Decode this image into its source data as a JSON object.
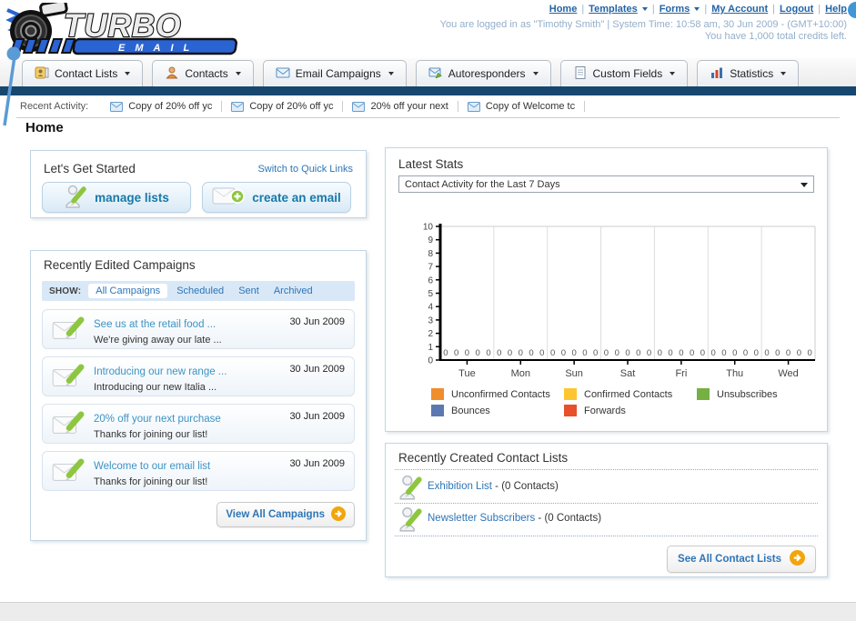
{
  "colors": {
    "navy_bar": "#17476e",
    "link_blue": "#2e75b6",
    "campaign_link": "#3d93c4",
    "accent_orange": "#f2a50c",
    "pencil_green": "#8dc63f",
    "muted_header_text": "#93aecb"
  },
  "header": {
    "logo": {
      "title": "TURBO",
      "subtitle": "EMAIL"
    },
    "separator": "|",
    "nav_links": [
      {
        "label": "Home"
      },
      {
        "label": "Templates"
      },
      {
        "label": "Forms"
      },
      {
        "label": "My Account"
      },
      {
        "label": "Logout"
      },
      {
        "label": "Help"
      }
    ],
    "login_text": "You are logged in as \"Timothy Smith\" | System Time: 10:58 am, 30 Jun 2009 - (GMT+10:00)",
    "credits_text": "You have 1,000 total credits left."
  },
  "tabs": [
    {
      "label": "Contact Lists"
    },
    {
      "label": "Contacts"
    },
    {
      "label": "Email Campaigns"
    },
    {
      "label": "Autoresponders"
    },
    {
      "label": "Custom Fields"
    },
    {
      "label": "Statistics"
    }
  ],
  "recent_activity": {
    "label": "Recent Activity:",
    "items": [
      {
        "label": "Copy of 20% off yc"
      },
      {
        "label": "Copy of 20% off yc"
      },
      {
        "label": "20% off your next "
      },
      {
        "label": "Copy of Welcome tc"
      }
    ]
  },
  "page_title": "Home",
  "get_started": {
    "title": "Let's Get Started",
    "switch_link": "Switch to Quick Links",
    "manage_lists_label": "manage lists",
    "create_email_label": "create an email"
  },
  "campaigns": {
    "title": "Recently Edited Campaigns",
    "show_label": "SHOW:",
    "filters": [
      {
        "label": "All Campaigns",
        "active": true
      },
      {
        "label": "Scheduled",
        "active": false
      },
      {
        "label": "Sent",
        "active": false
      },
      {
        "label": "Archived",
        "active": false
      }
    ],
    "items": [
      {
        "title": "See us at the retail food ...",
        "subtitle": "We're giving away our late ...",
        "date": "30 Jun 2009"
      },
      {
        "title": "Introducing our new range ...",
        "subtitle": "Introducing our new Italia ...",
        "date": "30 Jun 2009"
      },
      {
        "title": "20% off your next purchase",
        "subtitle": "Thanks for joining our list!",
        "date": "30 Jun 2009"
      },
      {
        "title": "Welcome to our email list",
        "subtitle": "Thanks for joining our list!",
        "date": "30 Jun 2009"
      }
    ],
    "view_all_label": "View All Campaigns"
  },
  "stats": {
    "title": "Latest Stats",
    "dropdown_value": "Contact Activity for the Last 7 Days"
  },
  "chart_data": {
    "type": "bar",
    "title": "Contact Activity for the Last 7 Days",
    "categories": [
      "Tue",
      "Mon",
      "Sun",
      "Sat",
      "Fri",
      "Thu",
      "Wed"
    ],
    "series": [
      {
        "name": "Unconfirmed Contacts",
        "color": "#ef8e2b",
        "values": [
          0,
          0,
          0,
          0,
          0,
          0,
          0
        ]
      },
      {
        "name": "Confirmed Contacts",
        "color": "#fdc52f",
        "values": [
          0,
          0,
          0,
          0,
          0,
          0,
          0
        ]
      },
      {
        "name": "Unsubscribes",
        "color": "#76b043",
        "values": [
          0,
          0,
          0,
          0,
          0,
          0,
          0
        ]
      },
      {
        "name": "Bounces",
        "color": "#5b79b0",
        "values": [
          0,
          0,
          0,
          0,
          0,
          0,
          0
        ]
      },
      {
        "name": "Forwards",
        "color": "#e8502b",
        "values": [
          0,
          0,
          0,
          0,
          0,
          0,
          0
        ]
      }
    ],
    "ylim": [
      0,
      10
    ],
    "ytick_step": 1,
    "value_labels": true,
    "grid": "vertical-category-separators",
    "legend_position": "bottom"
  },
  "contact_lists": {
    "title": "Recently Created Contact Lists",
    "items": [
      {
        "name": "Exhibition List",
        "detail": " - (0 Contacts)"
      },
      {
        "name": "Newsletter Subscribers",
        "detail": " - (0 Contacts)"
      }
    ],
    "see_all_label": "See All Contact Lists"
  }
}
